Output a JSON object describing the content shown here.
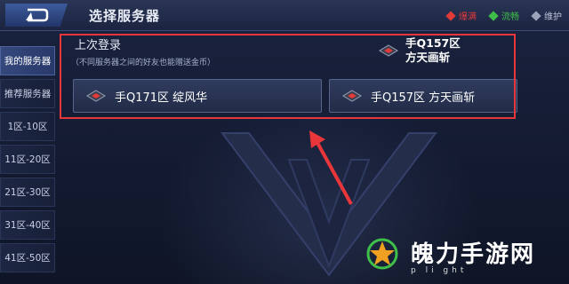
{
  "header": {
    "title": "选择服务器",
    "legend": [
      {
        "label": "爆满",
        "color": "#e03a3a"
      },
      {
        "label": "流畅",
        "color": "#3fbf4a"
      },
      {
        "label": "维护",
        "color": "#9aa3b8"
      }
    ]
  },
  "sidebar": {
    "items": [
      {
        "label": "我的服务器",
        "active": true
      },
      {
        "label": "推荐服务器",
        "active": false
      },
      {
        "label": "1区-10区",
        "active": false
      },
      {
        "label": "11区-20区",
        "active": false
      },
      {
        "label": "21区-30区",
        "active": false
      },
      {
        "label": "31区-40区",
        "active": false
      },
      {
        "label": "41区-50区",
        "active": false
      }
    ]
  },
  "main": {
    "last_login_label": "上次登录",
    "note": "（不同服务器之间的好友也能赠送金币）",
    "last_server_line1": "手Q157区",
    "last_server_line2": "方天画斩",
    "servers": [
      {
        "label": "手Q171区 绽风华"
      },
      {
        "label": "手Q157区 方天画斩"
      }
    ]
  },
  "watermark": {
    "text": "魄力手游网",
    "sub": "p li ght"
  },
  "colors": {
    "accent": "#e8363a",
    "panel": "#2a3556"
  }
}
